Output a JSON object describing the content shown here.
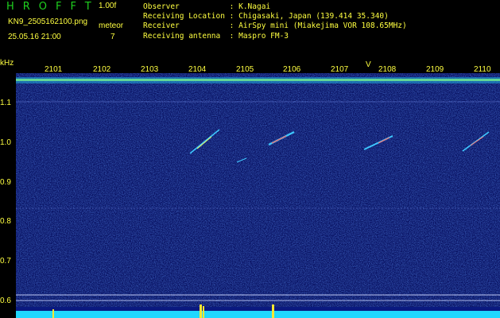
{
  "header": {
    "logo": "HROFFT",
    "version": "1.00f",
    "filename": "KN9_2505162100.png",
    "mode": "meteor",
    "timestamp": "25.05.16 21:00",
    "count": "7",
    "info": [
      "Observer           : K.Nagai",
      "Receiving Location : Chigasaki, Japan (139.414 35.340)",
      "Receiver           : AirSpy mini (Miakejima VOR 108.65MHz)",
      "Receiving antenna  : Maspro FM-3"
    ]
  },
  "axis": {
    "unit": "kHz",
    "y_ticks": [
      "1.1",
      "1.0",
      "0.9",
      "0.8",
      "0.7",
      "0.6"
    ],
    "x_ticks": [
      "2101",
      "2102",
      "2103",
      "2104",
      "2105",
      "2106",
      "2107",
      "2108",
      "2109",
      "2110"
    ],
    "marker": "V"
  },
  "colors": {
    "background": "#000000",
    "label": "#ffff40",
    "logo": "#1fd01f",
    "noise": "#1428a0",
    "carrier": "#20d8ff"
  }
}
